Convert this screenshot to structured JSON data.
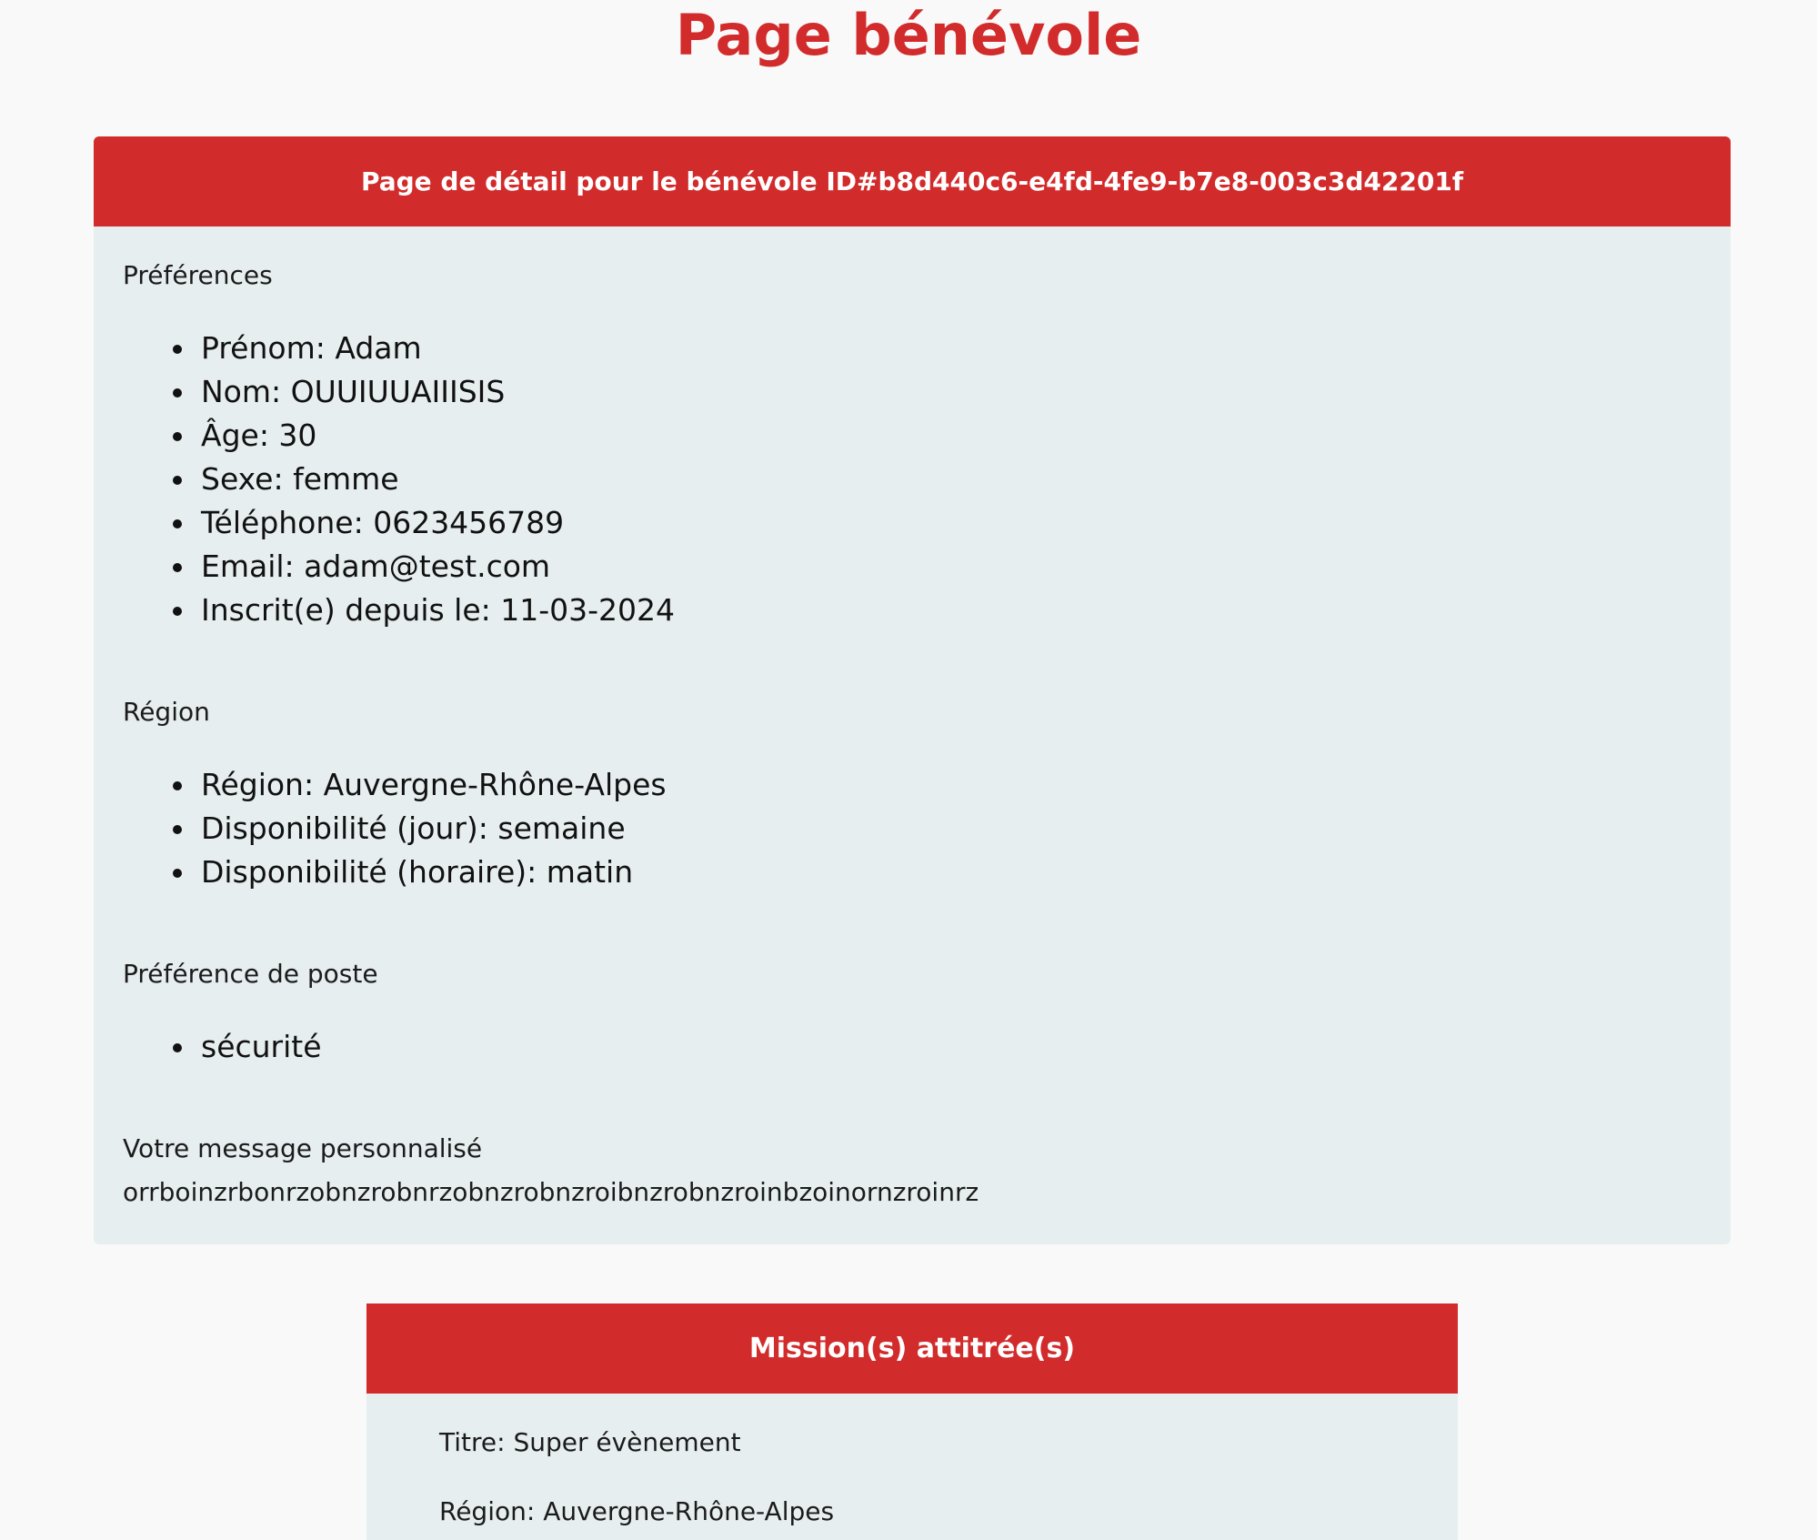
{
  "page": {
    "title": "Page bénévole"
  },
  "detail": {
    "header": "Page de détail pour le bénévole ID#b8d440c6-e4fd-4fe9-b7e8-003c3d42201f",
    "preferences": {
      "label": "Préférences",
      "items": [
        "Prénom: Adam",
        "Nom: OUUIUUAIIISIS",
        "Âge: 30",
        "Sexe: femme",
        "Téléphone: 0623456789",
        "Email: adam@test.com",
        "Inscrit(e) depuis le: 11-03-2024"
      ]
    },
    "region": {
      "label": "Région",
      "items": [
        "Région: Auvergne-Rhône-Alpes",
        "Disponibilité (jour): semaine",
        "Disponibilité (horaire): matin"
      ]
    },
    "post_preference": {
      "label": "Préférence de poste",
      "items": [
        "sécurité"
      ]
    },
    "message": {
      "label": "Votre message personnalisé",
      "text": "orrboinzrbonrzobnzrobnrzobnzrobnzroibnzrobnzroinbzoinornzroinrz"
    }
  },
  "missions": {
    "header": "Mission(s) attitrée(s)",
    "items": [
      {
        "title": "Titre: Super évènement",
        "region": "Région: Auvergne-Rhône-Alpes"
      }
    ]
  },
  "colors": {
    "accent": "#d22b2b",
    "card_background": "#e7eef0",
    "page_background": "#f9f9f9"
  }
}
